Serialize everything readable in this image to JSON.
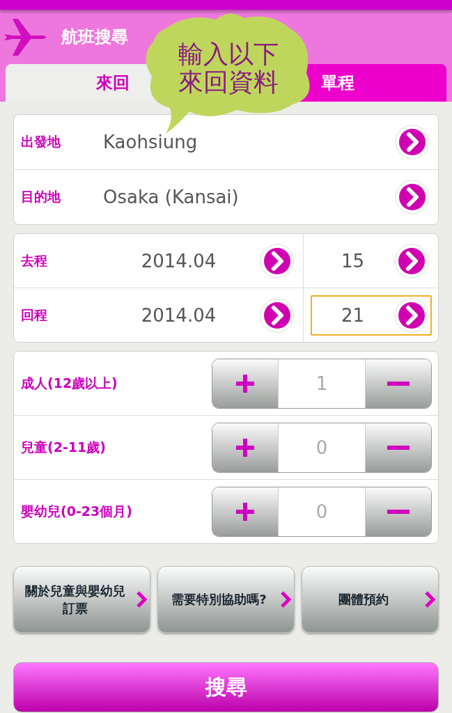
{
  "header": {
    "title": "航班搜尋"
  },
  "tabs": [
    {
      "label": "來回",
      "selected": true
    },
    {
      "label": "單程",
      "selected": false
    }
  ],
  "callout": {
    "lines": [
      "輸入以下",
      "來回資料"
    ]
  },
  "places": [
    {
      "label": "出發地",
      "value": "Kaohsiung"
    },
    {
      "label": "目的地",
      "value": "Osaka (Kansai)"
    }
  ],
  "dates": [
    {
      "label": "去程",
      "month": "2014.04",
      "day": "15",
      "focused": false
    },
    {
      "label": "回程",
      "month": "2014.04",
      "day": "21",
      "focused": true
    }
  ],
  "passengers": [
    {
      "label": "成人(12歲以上)",
      "count": "1"
    },
    {
      "label": "兒童(2-11歲)",
      "count": "0"
    },
    {
      "label": "嬰幼兒(0-23個月)",
      "count": "0"
    }
  ],
  "links": [
    {
      "lines": [
        "關於兒童與嬰幼兒",
        "訂票"
      ]
    },
    {
      "lines": [
        "需要特別協助嗎?"
      ]
    },
    {
      "lines": [
        "團體預約"
      ]
    }
  ],
  "search_button": {
    "label": "搜尋"
  }
}
